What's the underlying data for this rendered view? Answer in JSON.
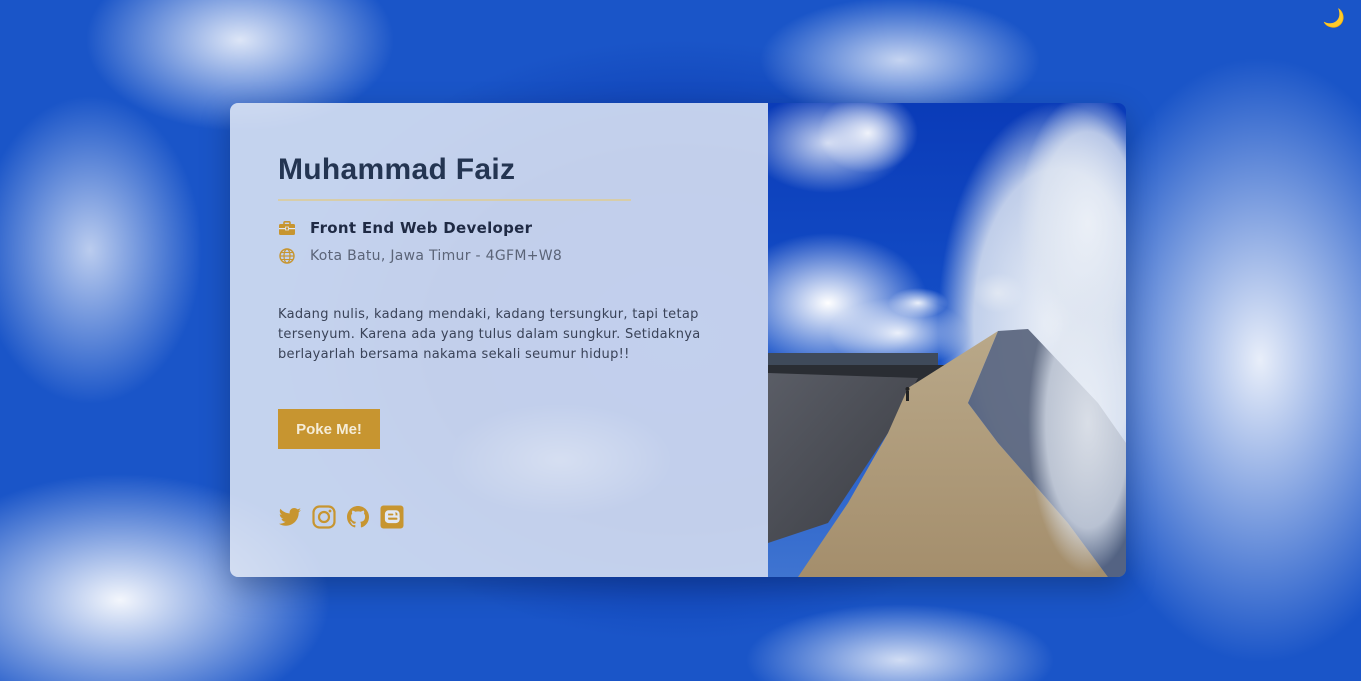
{
  "theme_toggle": {
    "icon": "moon-icon"
  },
  "profile": {
    "name": "Muhammad Faiz",
    "job": "Front End Web Developer",
    "location": "Kota Batu, Jawa Timur - 4GFM+W8",
    "bio": "Kadang nulis, kadang mendaki, kadang tersungkur, tapi tetap tersenyum. Karena ada yang tulus dalam sungkur. Setidaknya berlayarlah bersama nakama sekali seumur hidup!!",
    "button_label": "Poke Me!"
  },
  "icons": {
    "job": "briefcase-icon",
    "location": "globe-icon",
    "socials": [
      "twitter-icon",
      "instagram-icon",
      "github-icon",
      "blogger-icon"
    ]
  },
  "colors": {
    "accent": "#c79530",
    "title": "#243552",
    "card_bg": "#e1e8f5"
  }
}
